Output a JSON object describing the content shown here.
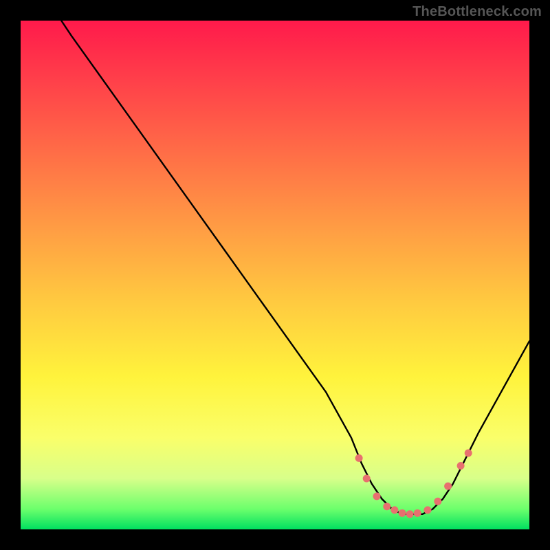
{
  "attribution": "TheBottleneck.com",
  "chart_data": {
    "type": "line",
    "title": "",
    "xlabel": "",
    "ylabel": "",
    "xlim": [
      0,
      100
    ],
    "ylim": [
      0,
      100
    ],
    "series": [
      {
        "name": "bottleneck-curve",
        "x": [
          8,
          10,
          15,
          20,
          25,
          30,
          35,
          40,
          45,
          50,
          55,
          60,
          65,
          67,
          69,
          71,
          73,
          75,
          77,
          79,
          81,
          83,
          85,
          87,
          90,
          95,
          100
        ],
        "y": [
          100,
          97,
          90,
          83,
          76,
          69,
          62,
          55,
          48,
          41,
          34,
          27,
          18,
          13,
          9,
          6,
          4,
          3,
          3,
          3,
          4,
          6,
          9,
          13,
          19,
          28,
          37
        ]
      }
    ],
    "markers": {
      "name": "highlight-dots",
      "x": [
        66.5,
        68,
        70,
        72,
        73.5,
        75,
        76.5,
        78,
        80,
        82,
        84,
        86.5,
        88
      ],
      "y": [
        14,
        10,
        6.5,
        4.5,
        3.8,
        3.2,
        3.0,
        3.2,
        3.8,
        5.5,
        8.5,
        12.5,
        15
      ]
    },
    "gradient_stops": [
      {
        "pos": 0,
        "color": "#ff1a4b"
      },
      {
        "pos": 10,
        "color": "#ff3a4a"
      },
      {
        "pos": 25,
        "color": "#ff6a47"
      },
      {
        "pos": 40,
        "color": "#ff9a44"
      },
      {
        "pos": 55,
        "color": "#ffc940"
      },
      {
        "pos": 70,
        "color": "#fff33c"
      },
      {
        "pos": 82,
        "color": "#faff6a"
      },
      {
        "pos": 90,
        "color": "#d8ff8a"
      },
      {
        "pos": 96,
        "color": "#6cff6c"
      },
      {
        "pos": 100,
        "color": "#00e060"
      }
    ],
    "marker_color": "#e8706f",
    "curve_color": "#000000"
  }
}
